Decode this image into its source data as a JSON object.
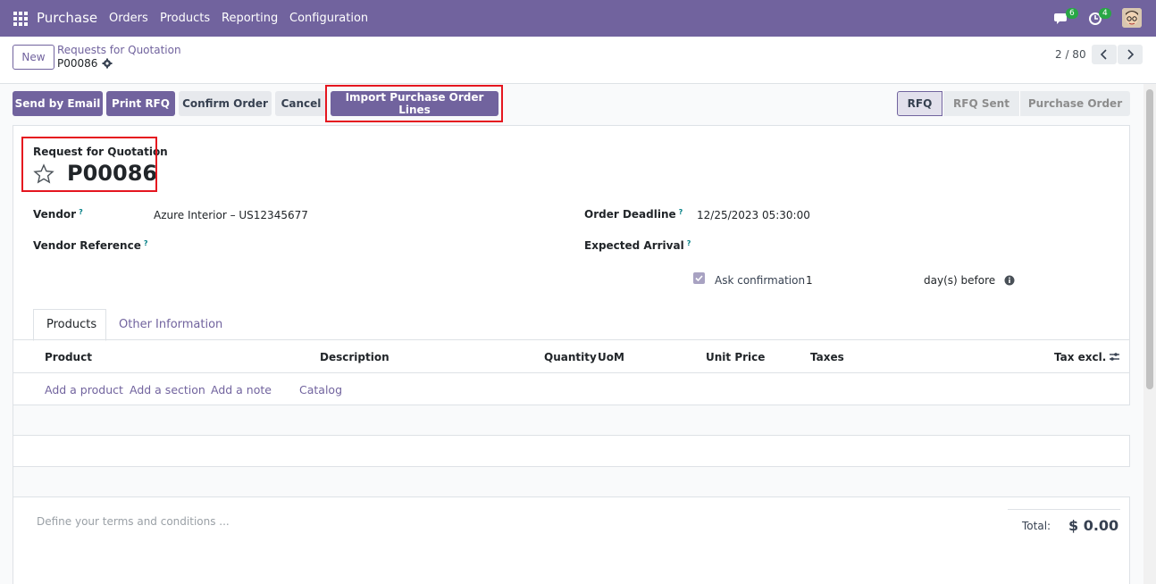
{
  "nav": {
    "app_name": "Purchase",
    "menus": [
      "Orders",
      "Products",
      "Reporting",
      "Configuration"
    ],
    "messages_count": "6",
    "activities_count": "4"
  },
  "control": {
    "new_label": "New",
    "breadcrumb_parent": "Requests for Quotation",
    "breadcrumb_current": "P00086",
    "pager": "2 / 80"
  },
  "actions": {
    "send_email": "Send by Email",
    "print_rfq": "Print RFQ",
    "confirm_order": "Confirm Order",
    "cancel": "Cancel",
    "import_lines": "Import Purchase Order Lines"
  },
  "status": {
    "steps": [
      "RFQ",
      "RFQ Sent",
      "Purchase Order"
    ],
    "active": "RFQ"
  },
  "form": {
    "title_label": "Request for Quotation",
    "order_name": "P00086",
    "vendor_label": "Vendor",
    "vendor_value": "Azure Interior – US12345677",
    "vendor_ref_label": "Vendor Reference",
    "deadline_label": "Order Deadline",
    "deadline_value": "12/25/2023 05:30:00",
    "arrival_label": "Expected Arrival",
    "ask_confirmation_label": "Ask confirmation",
    "ask_confirmation_days": "1",
    "days_before": "day(s) before",
    "help_mark": "?"
  },
  "tabs": [
    "Products",
    "Other Information"
  ],
  "lines_table": {
    "headers": {
      "product": "Product",
      "description": "Description",
      "quantity": "Quantity",
      "uom": "UoM",
      "unit_price": "Unit Price",
      "taxes": "Taxes",
      "tax_excl": "Tax excl."
    },
    "add_product": "Add a product",
    "add_section": "Add a section",
    "add_note": "Add a note",
    "catalog": "Catalog"
  },
  "footer": {
    "terms_placeholder": "Define your terms and conditions ...",
    "total_label": "Total:",
    "total_value": "$ 0.00"
  },
  "colors": {
    "brand": "#71639e",
    "highlight": "#e5161f",
    "badge": "#28a745"
  }
}
